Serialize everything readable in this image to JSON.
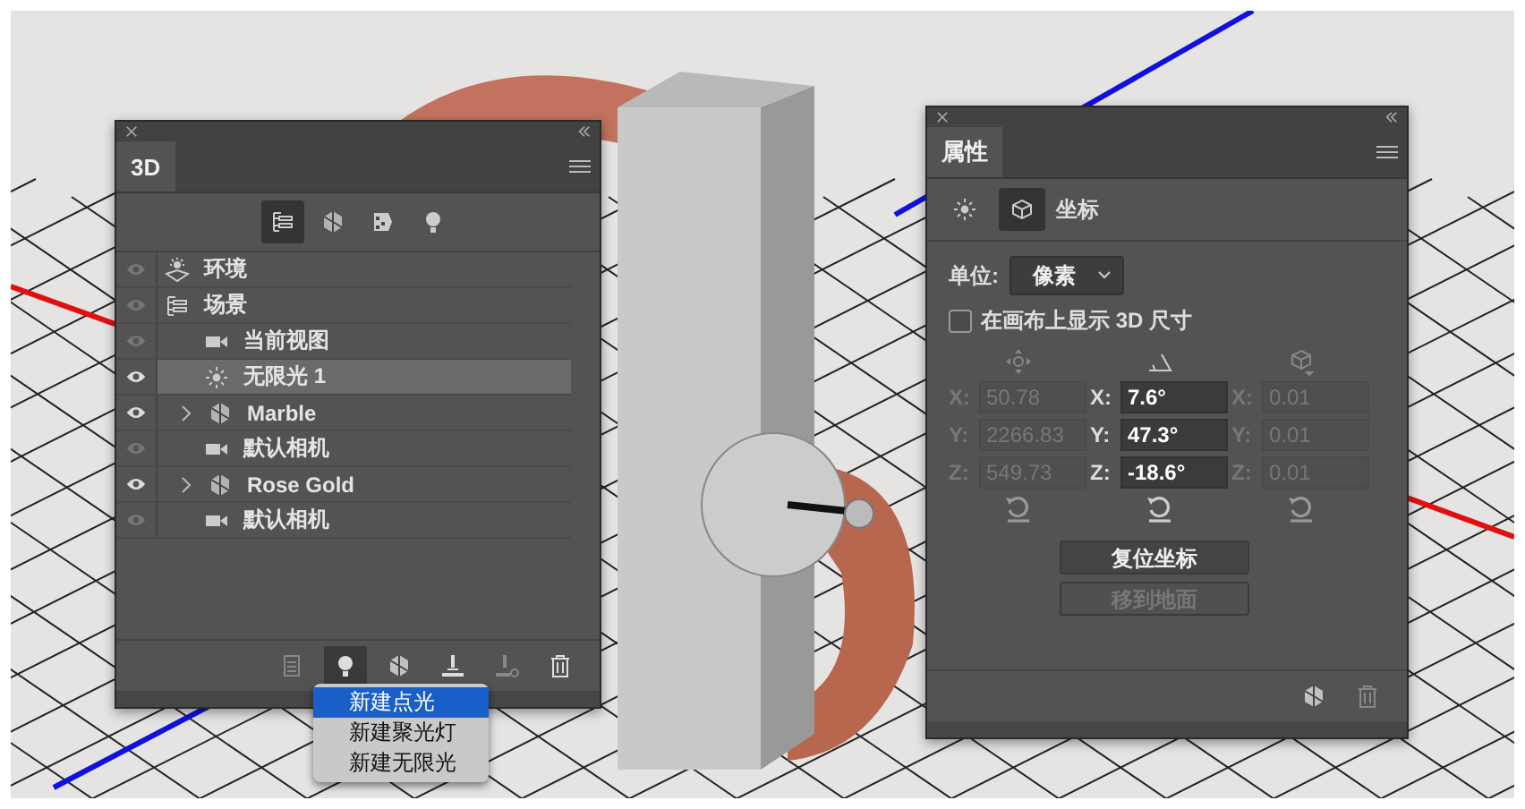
{
  "layers_panel": {
    "tab": "3D",
    "filters": [
      {
        "kind": "scene",
        "selected": true
      },
      {
        "kind": "mesh",
        "selected": false
      },
      {
        "kind": "material",
        "selected": false
      },
      {
        "kind": "light",
        "selected": false
      }
    ],
    "layers": [
      {
        "label": "环境",
        "kind": "environment",
        "visible": false,
        "selected": false
      },
      {
        "label": "场景",
        "kind": "scene",
        "visible": false,
        "selected": false,
        "children": [
          {
            "label": "当前视图",
            "kind": "camera",
            "visible": false,
            "selected": false
          },
          {
            "label": "无限光 1",
            "kind": "light",
            "visible": true,
            "selected": true
          },
          {
            "label": "Marble",
            "kind": "mesh",
            "visible": true,
            "selected": false,
            "expanded": false
          },
          {
            "label": "默认相机",
            "kind": "camera",
            "visible": false,
            "selected": false
          },
          {
            "label": "Rose Gold",
            "kind": "mesh",
            "visible": true,
            "selected": false,
            "expanded": false
          },
          {
            "label": "默认相机",
            "kind": "camera",
            "visible": false,
            "selected": false
          }
        ]
      }
    ],
    "toolbar": [
      {
        "kind": "render",
        "selected": false,
        "disabled": true
      },
      {
        "kind": "light",
        "selected": true,
        "disabled": false
      },
      {
        "kind": "mesh",
        "selected": false,
        "disabled": false
      },
      {
        "kind": "ground",
        "selected": false,
        "disabled": false
      },
      {
        "kind": "ground-remove",
        "selected": false,
        "disabled": true
      },
      {
        "kind": "trash",
        "selected": false,
        "disabled": false
      }
    ],
    "menu": [
      {
        "label": "新建点光",
        "selected": true
      },
      {
        "label": "新建聚光灯",
        "selected": false
      },
      {
        "label": "新建无限光",
        "selected": false
      }
    ]
  },
  "properties_panel": {
    "tab": "属性",
    "modes": [
      {
        "kind": "light",
        "selected": false
      },
      {
        "kind": "coordinates",
        "selected": true,
        "label": "坐标"
      }
    ],
    "unit_label": "单位:",
    "unit_value": "像素",
    "show_size": {
      "label": "在画布上显示 3D 尺寸",
      "checked": false
    },
    "columns": [
      {
        "kind": "move",
        "disabled": true,
        "fields": [
          {
            "axis": "X:",
            "value": "50.78"
          },
          {
            "axis": "Y:",
            "value": "2266.83"
          },
          {
            "axis": "Z:",
            "value": "549.73"
          }
        ]
      },
      {
        "kind": "rotate",
        "disabled": false,
        "fields": [
          {
            "axis": "X:",
            "value": "7.6°"
          },
          {
            "axis": "Y:",
            "value": "47.3°"
          },
          {
            "axis": "Z:",
            "value": "-18.6°"
          }
        ]
      },
      {
        "kind": "scale",
        "disabled": true,
        "fields": [
          {
            "axis": "X:",
            "value": "0.01"
          },
          {
            "axis": "Y:",
            "value": "0.01"
          },
          {
            "axis": "Z:",
            "value": "0.01"
          }
        ]
      }
    ],
    "buttons": [
      {
        "label": "复位坐标",
        "disabled": false
      },
      {
        "label": "移到地面",
        "disabled": true
      }
    ]
  }
}
